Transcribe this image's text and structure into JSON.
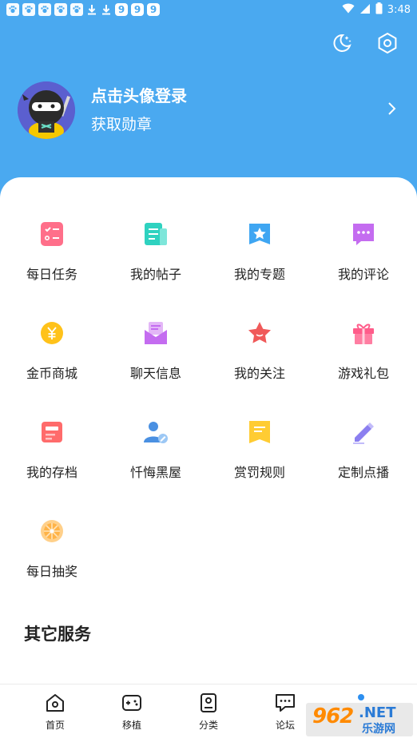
{
  "status_bar": {
    "time": "3:48",
    "nine_labels": [
      "9",
      "9",
      "9"
    ]
  },
  "header": {
    "login_title": "点击头像登录",
    "login_subtitle": "获取勋章"
  },
  "grid": [
    {
      "label": "每日任务",
      "icon": "task-checklist-icon",
      "color": "#ff6f8a"
    },
    {
      "label": "我的帖子",
      "icon": "document-icon",
      "color": "#2fd2c0"
    },
    {
      "label": "我的专题",
      "icon": "star-bookmark-icon",
      "color": "#3fa6f2"
    },
    {
      "label": "我的评论",
      "icon": "comment-bubble-icon",
      "color": "#c46cf0"
    },
    {
      "label": "金币商城",
      "icon": "gold-coin-icon",
      "color": "#ffc21a"
    },
    {
      "label": "聊天信息",
      "icon": "mail-message-icon",
      "color": "#c46cf0"
    },
    {
      "label": "我的关注",
      "icon": "star-icon",
      "color": "#f05a5a"
    },
    {
      "label": "游戏礼包",
      "icon": "gift-box-icon",
      "color": "#ff5c8a"
    },
    {
      "label": "我的存档",
      "icon": "archive-icon",
      "color": "#ff6b6b"
    },
    {
      "label": "忏悔黑屋",
      "icon": "user-edit-icon",
      "color": "#4a90e2"
    },
    {
      "label": "赏罚规则",
      "icon": "rules-badge-icon",
      "color": "#ffcc33"
    },
    {
      "label": "定制点播",
      "icon": "pencil-icon",
      "color": "#8b7ff0"
    },
    {
      "label": "每日抽奖",
      "icon": "lottery-wheel-icon",
      "color": "#ffb347"
    }
  ],
  "section_title": "其它服务",
  "bottom_nav": [
    {
      "label": "首页",
      "icon": "home-icon"
    },
    {
      "label": "移植",
      "icon": "gamepad-icon"
    },
    {
      "label": "分类",
      "icon": "category-book-icon"
    },
    {
      "label": "论坛",
      "icon": "forum-chat-icon"
    }
  ],
  "watermark": {
    "main": "962",
    "net": ".NET",
    "cn": "乐游网"
  },
  "colors": {
    "header_bg": "#4aa9f0",
    "accent": "#2d8ff0"
  }
}
